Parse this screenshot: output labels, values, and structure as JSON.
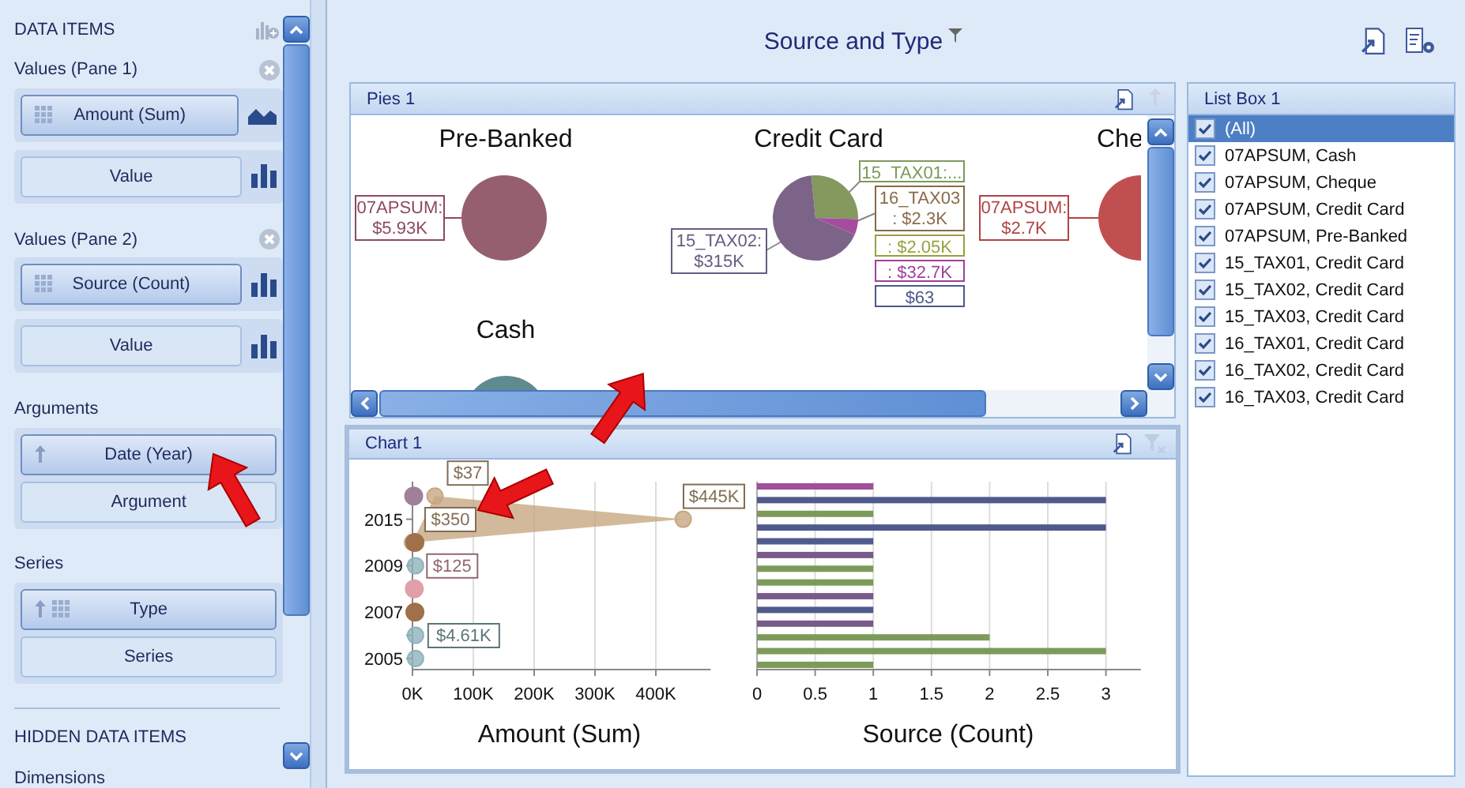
{
  "data_items_panel": {
    "header": "DATA ITEMS",
    "sections": [
      {
        "title": "Values (Pane 1)",
        "removable": true,
        "groups": [
          {
            "kind": "area",
            "slots": [
              {
                "label": "Amount (Sum)",
                "filled": true,
                "grip": true,
                "sort": false
              }
            ]
          },
          {
            "kind": "bar",
            "slots": [
              {
                "label": "Value",
                "filled": false,
                "grip": false,
                "sort": false
              }
            ]
          }
        ]
      },
      {
        "title": "Values (Pane 2)",
        "removable": true,
        "groups": [
          {
            "kind": "bar",
            "slots": [
              {
                "label": "Source (Count)",
                "filled": true,
                "grip": true,
                "sort": false
              }
            ]
          },
          {
            "kind": "bar",
            "slots": [
              {
                "label": "Value",
                "filled": false,
                "grip": false,
                "sort": false
              }
            ]
          }
        ]
      },
      {
        "title": "Arguments",
        "removable": false,
        "groups": [
          {
            "kind": "plain",
            "slots": [
              {
                "label": "Date (Year)",
                "filled": true,
                "grip": false,
                "sort": true
              },
              {
                "label": "Argument",
                "filled": false,
                "grip": false,
                "sort": false
              }
            ]
          }
        ]
      },
      {
        "title": "Series",
        "removable": false,
        "groups": [
          {
            "kind": "plain",
            "slots": [
              {
                "label": "Type",
                "filled": true,
                "grip": true,
                "sort": true
              },
              {
                "label": "Series",
                "filled": false,
                "grip": false,
                "sort": false
              }
            ]
          }
        ]
      }
    ],
    "hidden_header": "HIDDEN DATA ITEMS",
    "hidden_sections": [
      "Dimensions"
    ]
  },
  "dashboard": {
    "title": "Source and Type",
    "filtered": true
  },
  "pies": {
    "title": "Pies 1",
    "items": [
      {
        "title": "Pre-Banked",
        "labels": [
          {
            "text": "07APSUM:",
            "value": "$5.93K",
            "color": "#8e4a5c"
          }
        ],
        "slices": [
          {
            "color": "#955f6e"
          }
        ]
      },
      {
        "title": "Credit Card",
        "labels": [
          {
            "text": "15_TAX02:",
            "value": "$315K",
            "color": "#6a5a82"
          },
          {
            "text": "15_TAX01:...",
            "color": "#7d9a5a"
          },
          {
            "text": "16_TAX03",
            "value": ": $2.3K",
            "color": "#8a6a4a"
          },
          {
            "text": ": $2.05K",
            "color": "#9aa040"
          },
          {
            "text": ": $32.7K",
            "color": "#a0409a"
          },
          {
            "text": "$63",
            "color": "#4a5a8a"
          }
        ],
        "slices": [
          {
            "color": "#84995e"
          },
          {
            "color": "#a64c9e"
          },
          {
            "color": "#7c6488"
          }
        ]
      },
      {
        "title": "Che",
        "labels": [
          {
            "text": "07APSUM:",
            "value": "$2.7K",
            "color": "#b04444"
          }
        ],
        "slices": [
          {
            "color": "#c05050"
          }
        ]
      },
      {
        "title": "Cash",
        "slices": [
          {
            "color": "#5f8a90"
          }
        ]
      }
    ]
  },
  "chart": {
    "title": "Chart 1",
    "panes": [
      {
        "chart_data": {
          "type": "scatter",
          "orientation": "horizontal",
          "grid": true,
          "xlabel": "Amount (Sum)",
          "xlim": [
            0,
            490000
          ],
          "xticks": [
            {
              "value": 0,
              "label": "0K"
            },
            {
              "value": 100000,
              "label": "100K"
            },
            {
              "value": 200000,
              "label": "200K"
            },
            {
              "value": 300000,
              "label": "300K"
            },
            {
              "value": 400000,
              "label": "400K"
            }
          ],
          "categories": [
            null,
            "2015",
            null,
            "2009",
            null,
            "2007",
            null,
            "2005"
          ],
          "series": [
            {
              "color": "#8fb3bc",
              "values": [
                null,
                null,
                null,
                5000,
                null,
                null,
                5000,
                5000
              ]
            },
            {
              "color": "#a0704a",
              "values": [
                null,
                null,
                4000,
                null,
                null,
                4000,
                null,
                null
              ]
            },
            {
              "color": "#e0a0a8",
              "values": [
                null,
                null,
                null,
                null,
                3000,
                null,
                null,
                null
              ]
            },
            {
              "color": "#a08098",
              "values": [
                2000,
                null,
                null,
                null,
                null,
                null,
                null,
                null
              ]
            },
            {
              "color": "#c8a882",
              "values": [
                37000,
                445000,
                0,
                null,
                null,
                null,
                null,
                null
              ]
            }
          ],
          "annotations": [
            {
              "text": "$4.61K",
              "x": 5000,
              "y": "2005"
            },
            {
              "text": "$125",
              "x": 3000
            },
            "$37",
            {
              "text": "$445K",
              "x": 445000,
              "y": "2015"
            },
            "$350"
          ]
        }
      },
      {
        "chart_data": {
          "type": "bar",
          "orientation": "horizontal",
          "grid": true,
          "xlabel": "Source (Count)",
          "xlim": [
            0,
            3.3
          ],
          "xticks": [
            {
              "value": 0,
              "label": "0"
            },
            {
              "value": 0.5,
              "label": "0.5"
            },
            {
              "value": 1,
              "label": "1"
            },
            {
              "value": 1.5,
              "label": "1.5"
            },
            {
              "value": 2,
              "label": "2"
            },
            {
              "value": 2.5,
              "label": "2.5"
            },
            {
              "value": 3,
              "label": "3"
            }
          ],
          "series": [
            {
              "color": "#a0509a",
              "values": [
                1,
                null,
                null,
                null,
                null,
                null,
                null,
                null,
                null,
                null,
                null,
                null,
                null,
                null
              ]
            },
            {
              "color": "#505a8c",
              "values": [
                null,
                3,
                null,
                3,
                1,
                null,
                null,
                null,
                null,
                1,
                null,
                null,
                null,
                null
              ]
            },
            {
              "color": "#7d9a5a",
              "values": [
                null,
                null,
                1,
                null,
                null,
                null,
                1,
                1,
                null,
                null,
                null,
                2,
                3,
                1
              ]
            },
            {
              "color": "#7a5a8a",
              "values": [
                null,
                null,
                null,
                null,
                null,
                1,
                null,
                null,
                1,
                null,
                1,
                null,
                null,
                null
              ]
            }
          ]
        }
      }
    ]
  },
  "list_box": {
    "title": "List Box 1",
    "items": [
      {
        "label": "(All)",
        "checked": true,
        "selected": true
      },
      {
        "label": "07APSUM, Cash",
        "checked": true,
        "selected": false
      },
      {
        "label": "07APSUM, Cheque",
        "checked": true,
        "selected": false
      },
      {
        "label": "07APSUM, Credit Card",
        "checked": true,
        "selected": false
      },
      {
        "label": "07APSUM, Pre-Banked",
        "checked": true,
        "selected": false
      },
      {
        "label": "15_TAX01, Credit Card",
        "checked": true,
        "selected": false
      },
      {
        "label": "15_TAX02, Credit Card",
        "checked": true,
        "selected": false
      },
      {
        "label": "15_TAX03, Credit Card",
        "checked": true,
        "selected": false
      },
      {
        "label": "16_TAX01, Credit Card",
        "checked": true,
        "selected": false
      },
      {
        "label": "16_TAX02, Credit Card",
        "checked": true,
        "selected": false
      },
      {
        "label": "16_TAX03, Credit Card",
        "checked": true,
        "selected": false
      }
    ]
  }
}
